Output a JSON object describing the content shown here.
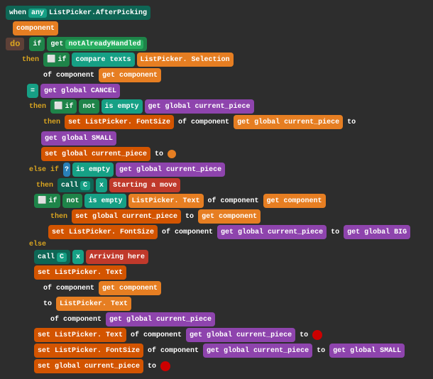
{
  "header": {
    "when_label": "when",
    "any_label": "any",
    "event": "ListPicker.AfterPicking",
    "do_label": "do",
    "component_label": "component"
  },
  "blocks": {
    "if_block_label": "if",
    "get_label": "get",
    "not_already_handled": "notAlreadyHandled",
    "then_label": "then",
    "if2_label": "if",
    "compare_texts_label": "compare texts",
    "listpicker_selection": "ListPicker. Selection",
    "of_component": "of component",
    "get_component": "get  component",
    "equals_label": "=",
    "get_global_cancel": "get global CANCEL",
    "then2_label": "then",
    "if3_label": "if",
    "not_label": "not",
    "is_empty_label": "is empty",
    "get_global_current_piece": "get global current_piece",
    "then3_label": "then",
    "set_listpicker_fontsize": "set ListPicker. FontSize",
    "of_component2": "of component",
    "get_global_current_piece2": "get global current_piece",
    "to_label": "to",
    "get_global_small": "get global SMALL",
    "set_global_current_piece": "set global current_piece",
    "to2": "to",
    "else_if_label": "else if",
    "question_mark": "?",
    "is_empty2": "is empty",
    "get_global_current_piece3": "get global current_piece",
    "then4_label": "then",
    "call_label": "call",
    "c_label": "C",
    "x_label": "x",
    "starting_move": "Starting a move",
    "if4_label": "if",
    "not2_label": "not",
    "is_empty3": "is empty",
    "listpicker_text": "ListPicker. Text",
    "of_component3": "of component",
    "get_component2": "get  component",
    "then5_label": "then",
    "set_global_current_piece2": "set global current_piece",
    "to3": "to",
    "get_component3": "get  component",
    "set_listpicker_fontsize2": "set ListPicker. FontSize",
    "of_component4": "of component",
    "get_global_current_piece4": "get global current_piece",
    "to4": "to",
    "get_global_big": "get global BIG",
    "else_label": "else",
    "call2_label": "call",
    "c2_label": "C",
    "x2_label": "x",
    "arriving_here": "Arriving here",
    "set_listpicker_text": "set ListPicker. Text",
    "of_component5": "of component",
    "get_component4": "get  component",
    "to5": "to",
    "listpicker_text2": "ListPicker. Text",
    "of_component6": "of component",
    "get_global_current_piece5": "get global current_piece",
    "set_listpicker_text2": "set ListPicker. Text",
    "of_component7": "of component",
    "get_global_current_piece6": "get global current_piece",
    "to6": "to",
    "circle1": "",
    "set_listpicker_fontsize3": "set ListPicker. FontSize",
    "of_component8": "of component",
    "get_global_current_piece7": "get global current_piece",
    "to7": "to",
    "get_global_small2": "get global SMALL",
    "set_global_current_piece2_label": "set global current_piece",
    "to8": "to",
    "circle2": ""
  }
}
